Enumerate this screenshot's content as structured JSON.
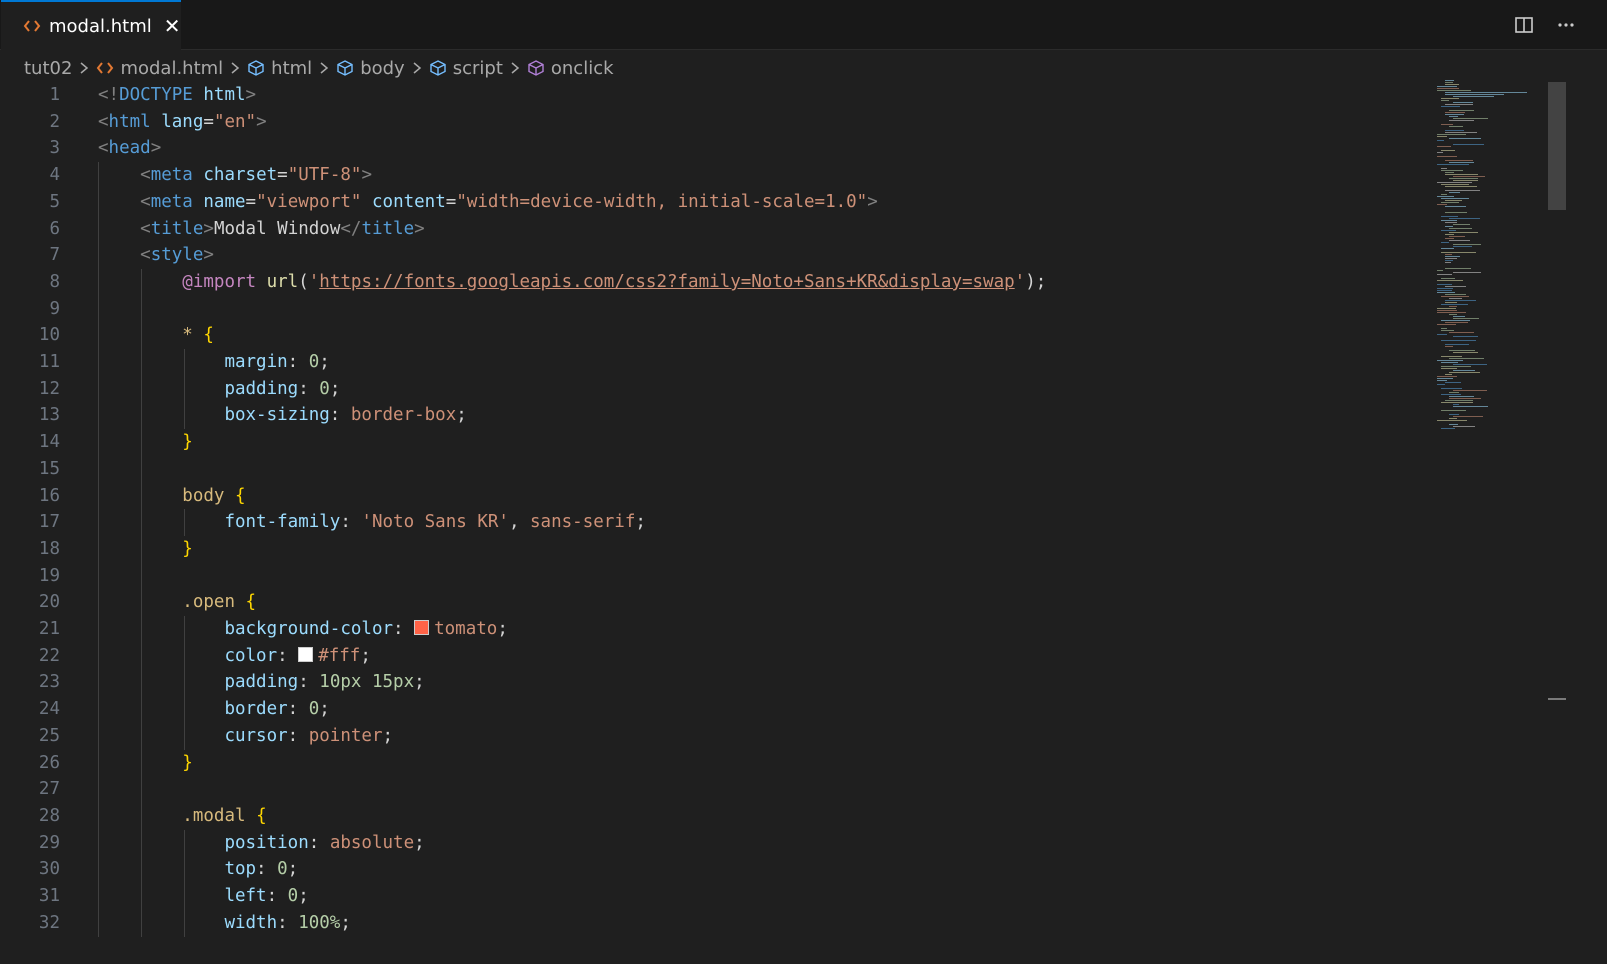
{
  "tab": {
    "label": "modal.html",
    "close": "✕",
    "icon": "html-file-icon"
  },
  "breadcrumb": {
    "folder": "tut02",
    "file": "modal.html",
    "nodes": [
      "html",
      "body",
      "script",
      "onclick"
    ]
  },
  "colors": {
    "tomato": "#ff6347",
    "white": "#ffffff",
    "accent": "#0078d4"
  },
  "lines": [
    {
      "n": "1",
      "t": [
        [
          "t-punct",
          "<!"
        ],
        [
          "t-tag",
          "DOCTYPE "
        ],
        [
          "t-attr",
          "html"
        ],
        [
          "t-punct",
          ">"
        ]
      ]
    },
    {
      "n": "2",
      "t": [
        [
          "t-punct",
          "<"
        ],
        [
          "t-tag",
          "html "
        ],
        [
          "t-attr",
          "lang"
        ],
        [
          "t-plain",
          "="
        ],
        [
          "t-str",
          "\"en\""
        ],
        [
          "t-punct",
          ">"
        ]
      ]
    },
    {
      "n": "3",
      "t": [
        [
          "t-punct",
          "<"
        ],
        [
          "t-tag",
          "head"
        ],
        [
          "t-punct",
          ">"
        ]
      ]
    },
    {
      "n": "4",
      "t": [
        [
          "t-plain",
          "    "
        ],
        [
          "t-punct",
          "<"
        ],
        [
          "t-tag",
          "meta "
        ],
        [
          "t-attr",
          "charset"
        ],
        [
          "t-plain",
          "="
        ],
        [
          "t-str",
          "\"UTF-8\""
        ],
        [
          "t-punct",
          ">"
        ]
      ]
    },
    {
      "n": "5",
      "t": [
        [
          "t-plain",
          "    "
        ],
        [
          "t-punct",
          "<"
        ],
        [
          "t-tag",
          "meta "
        ],
        [
          "t-attr",
          "name"
        ],
        [
          "t-plain",
          "="
        ],
        [
          "t-str",
          "\"viewport\" "
        ],
        [
          "t-attr",
          "content"
        ],
        [
          "t-plain",
          "="
        ],
        [
          "t-str",
          "\"width=device-width, initial-scale=1.0\""
        ],
        [
          "t-punct",
          ">"
        ]
      ]
    },
    {
      "n": "6",
      "t": [
        [
          "t-plain",
          "    "
        ],
        [
          "t-punct",
          "<"
        ],
        [
          "t-tag",
          "title"
        ],
        [
          "t-punct",
          ">"
        ],
        [
          "t-text",
          "Modal Window"
        ],
        [
          "t-punct",
          "</"
        ],
        [
          "t-tag",
          "title"
        ],
        [
          "t-punct",
          ">"
        ]
      ]
    },
    {
      "n": "7",
      "t": [
        [
          "t-plain",
          "    "
        ],
        [
          "t-punct",
          "<"
        ],
        [
          "t-tag",
          "style"
        ],
        [
          "t-punct",
          ">"
        ]
      ]
    },
    {
      "n": "8",
      "t": [
        [
          "t-plain",
          "        "
        ],
        [
          "t-at",
          "@import "
        ],
        [
          "t-func",
          "url"
        ],
        [
          "t-plain",
          "("
        ],
        [
          "t-str",
          "'"
        ],
        [
          "t-url",
          "https://fonts.googleapis.com/css2?family=Noto+Sans+KR&display=swap"
        ],
        [
          "t-str",
          "'"
        ],
        [
          "t-plain",
          ");"
        ]
      ]
    },
    {
      "n": "9",
      "t": []
    },
    {
      "n": "10",
      "t": [
        [
          "t-plain",
          "        "
        ],
        [
          "t-sel",
          "* "
        ],
        [
          "t-brace",
          "{"
        ]
      ]
    },
    {
      "n": "11",
      "t": [
        [
          "t-plain",
          "            "
        ],
        [
          "t-prop",
          "margin"
        ],
        [
          "t-plain",
          ": "
        ],
        [
          "t-num",
          "0"
        ],
        [
          "t-plain",
          ";"
        ]
      ]
    },
    {
      "n": "12",
      "t": [
        [
          "t-plain",
          "            "
        ],
        [
          "t-prop",
          "padding"
        ],
        [
          "t-plain",
          ": "
        ],
        [
          "t-num",
          "0"
        ],
        [
          "t-plain",
          ";"
        ]
      ]
    },
    {
      "n": "13",
      "t": [
        [
          "t-plain",
          "            "
        ],
        [
          "t-prop",
          "box-sizing"
        ],
        [
          "t-plain",
          ": "
        ],
        [
          "t-val",
          "border-box"
        ],
        [
          "t-plain",
          ";"
        ]
      ]
    },
    {
      "n": "14",
      "t": [
        [
          "t-plain",
          "        "
        ],
        [
          "t-brace",
          "}"
        ]
      ]
    },
    {
      "n": "15",
      "t": []
    },
    {
      "n": "16",
      "t": [
        [
          "t-plain",
          "        "
        ],
        [
          "t-sel",
          "body "
        ],
        [
          "t-brace",
          "{"
        ]
      ]
    },
    {
      "n": "17",
      "t": [
        [
          "t-plain",
          "            "
        ],
        [
          "t-prop",
          "font-family"
        ],
        [
          "t-plain",
          ": "
        ],
        [
          "t-val",
          "'Noto Sans KR'"
        ],
        [
          "t-plain",
          ", "
        ],
        [
          "t-val",
          "sans-serif"
        ],
        [
          "t-plain",
          ";"
        ]
      ]
    },
    {
      "n": "18",
      "t": [
        [
          "t-plain",
          "        "
        ],
        [
          "t-brace",
          "}"
        ]
      ]
    },
    {
      "n": "19",
      "t": []
    },
    {
      "n": "20",
      "t": [
        [
          "t-plain",
          "        "
        ],
        [
          "t-sel",
          ".open "
        ],
        [
          "t-brace",
          "{"
        ]
      ]
    },
    {
      "n": "21",
      "t": [
        [
          "t-plain",
          "            "
        ],
        [
          "t-prop",
          "background-color"
        ],
        [
          "t-plain",
          ": "
        ],
        [
          "swatch",
          "tomato"
        ],
        [
          "t-val",
          "tomato"
        ],
        [
          "t-plain",
          ";"
        ]
      ]
    },
    {
      "n": "22",
      "t": [
        [
          "t-plain",
          "            "
        ],
        [
          "t-prop",
          "color"
        ],
        [
          "t-plain",
          ": "
        ],
        [
          "swatch",
          "white"
        ],
        [
          "t-val",
          "#fff"
        ],
        [
          "t-plain",
          ";"
        ]
      ]
    },
    {
      "n": "23",
      "t": [
        [
          "t-plain",
          "            "
        ],
        [
          "t-prop",
          "padding"
        ],
        [
          "t-plain",
          ": "
        ],
        [
          "t-num",
          "10px 15px"
        ],
        [
          "t-plain",
          ";"
        ]
      ]
    },
    {
      "n": "24",
      "t": [
        [
          "t-plain",
          "            "
        ],
        [
          "t-prop",
          "border"
        ],
        [
          "t-plain",
          ": "
        ],
        [
          "t-num",
          "0"
        ],
        [
          "t-plain",
          ";"
        ]
      ]
    },
    {
      "n": "25",
      "t": [
        [
          "t-plain",
          "            "
        ],
        [
          "t-prop",
          "cursor"
        ],
        [
          "t-plain",
          ": "
        ],
        [
          "t-val",
          "pointer"
        ],
        [
          "t-plain",
          ";"
        ]
      ]
    },
    {
      "n": "26",
      "t": [
        [
          "t-plain",
          "        "
        ],
        [
          "t-brace",
          "}"
        ]
      ]
    },
    {
      "n": "27",
      "t": []
    },
    {
      "n": "28",
      "t": [
        [
          "t-plain",
          "        "
        ],
        [
          "t-sel",
          ".modal "
        ],
        [
          "t-brace",
          "{"
        ]
      ]
    },
    {
      "n": "29",
      "t": [
        [
          "t-plain",
          "            "
        ],
        [
          "t-prop",
          "position"
        ],
        [
          "t-plain",
          ": "
        ],
        [
          "t-val",
          "absolute"
        ],
        [
          "t-plain",
          ";"
        ]
      ]
    },
    {
      "n": "30",
      "t": [
        [
          "t-plain",
          "            "
        ],
        [
          "t-prop",
          "top"
        ],
        [
          "t-plain",
          ": "
        ],
        [
          "t-num",
          "0"
        ],
        [
          "t-plain",
          ";"
        ]
      ]
    },
    {
      "n": "31",
      "t": [
        [
          "t-plain",
          "            "
        ],
        [
          "t-prop",
          "left"
        ],
        [
          "t-plain",
          ": "
        ],
        [
          "t-num",
          "0"
        ],
        [
          "t-plain",
          ";"
        ]
      ]
    },
    {
      "n": "32",
      "t": [
        [
          "t-plain",
          "            "
        ],
        [
          "t-prop",
          "width"
        ],
        [
          "t-plain",
          ": "
        ],
        [
          "t-num",
          "100%"
        ],
        [
          "t-plain",
          ";"
        ]
      ]
    }
  ]
}
